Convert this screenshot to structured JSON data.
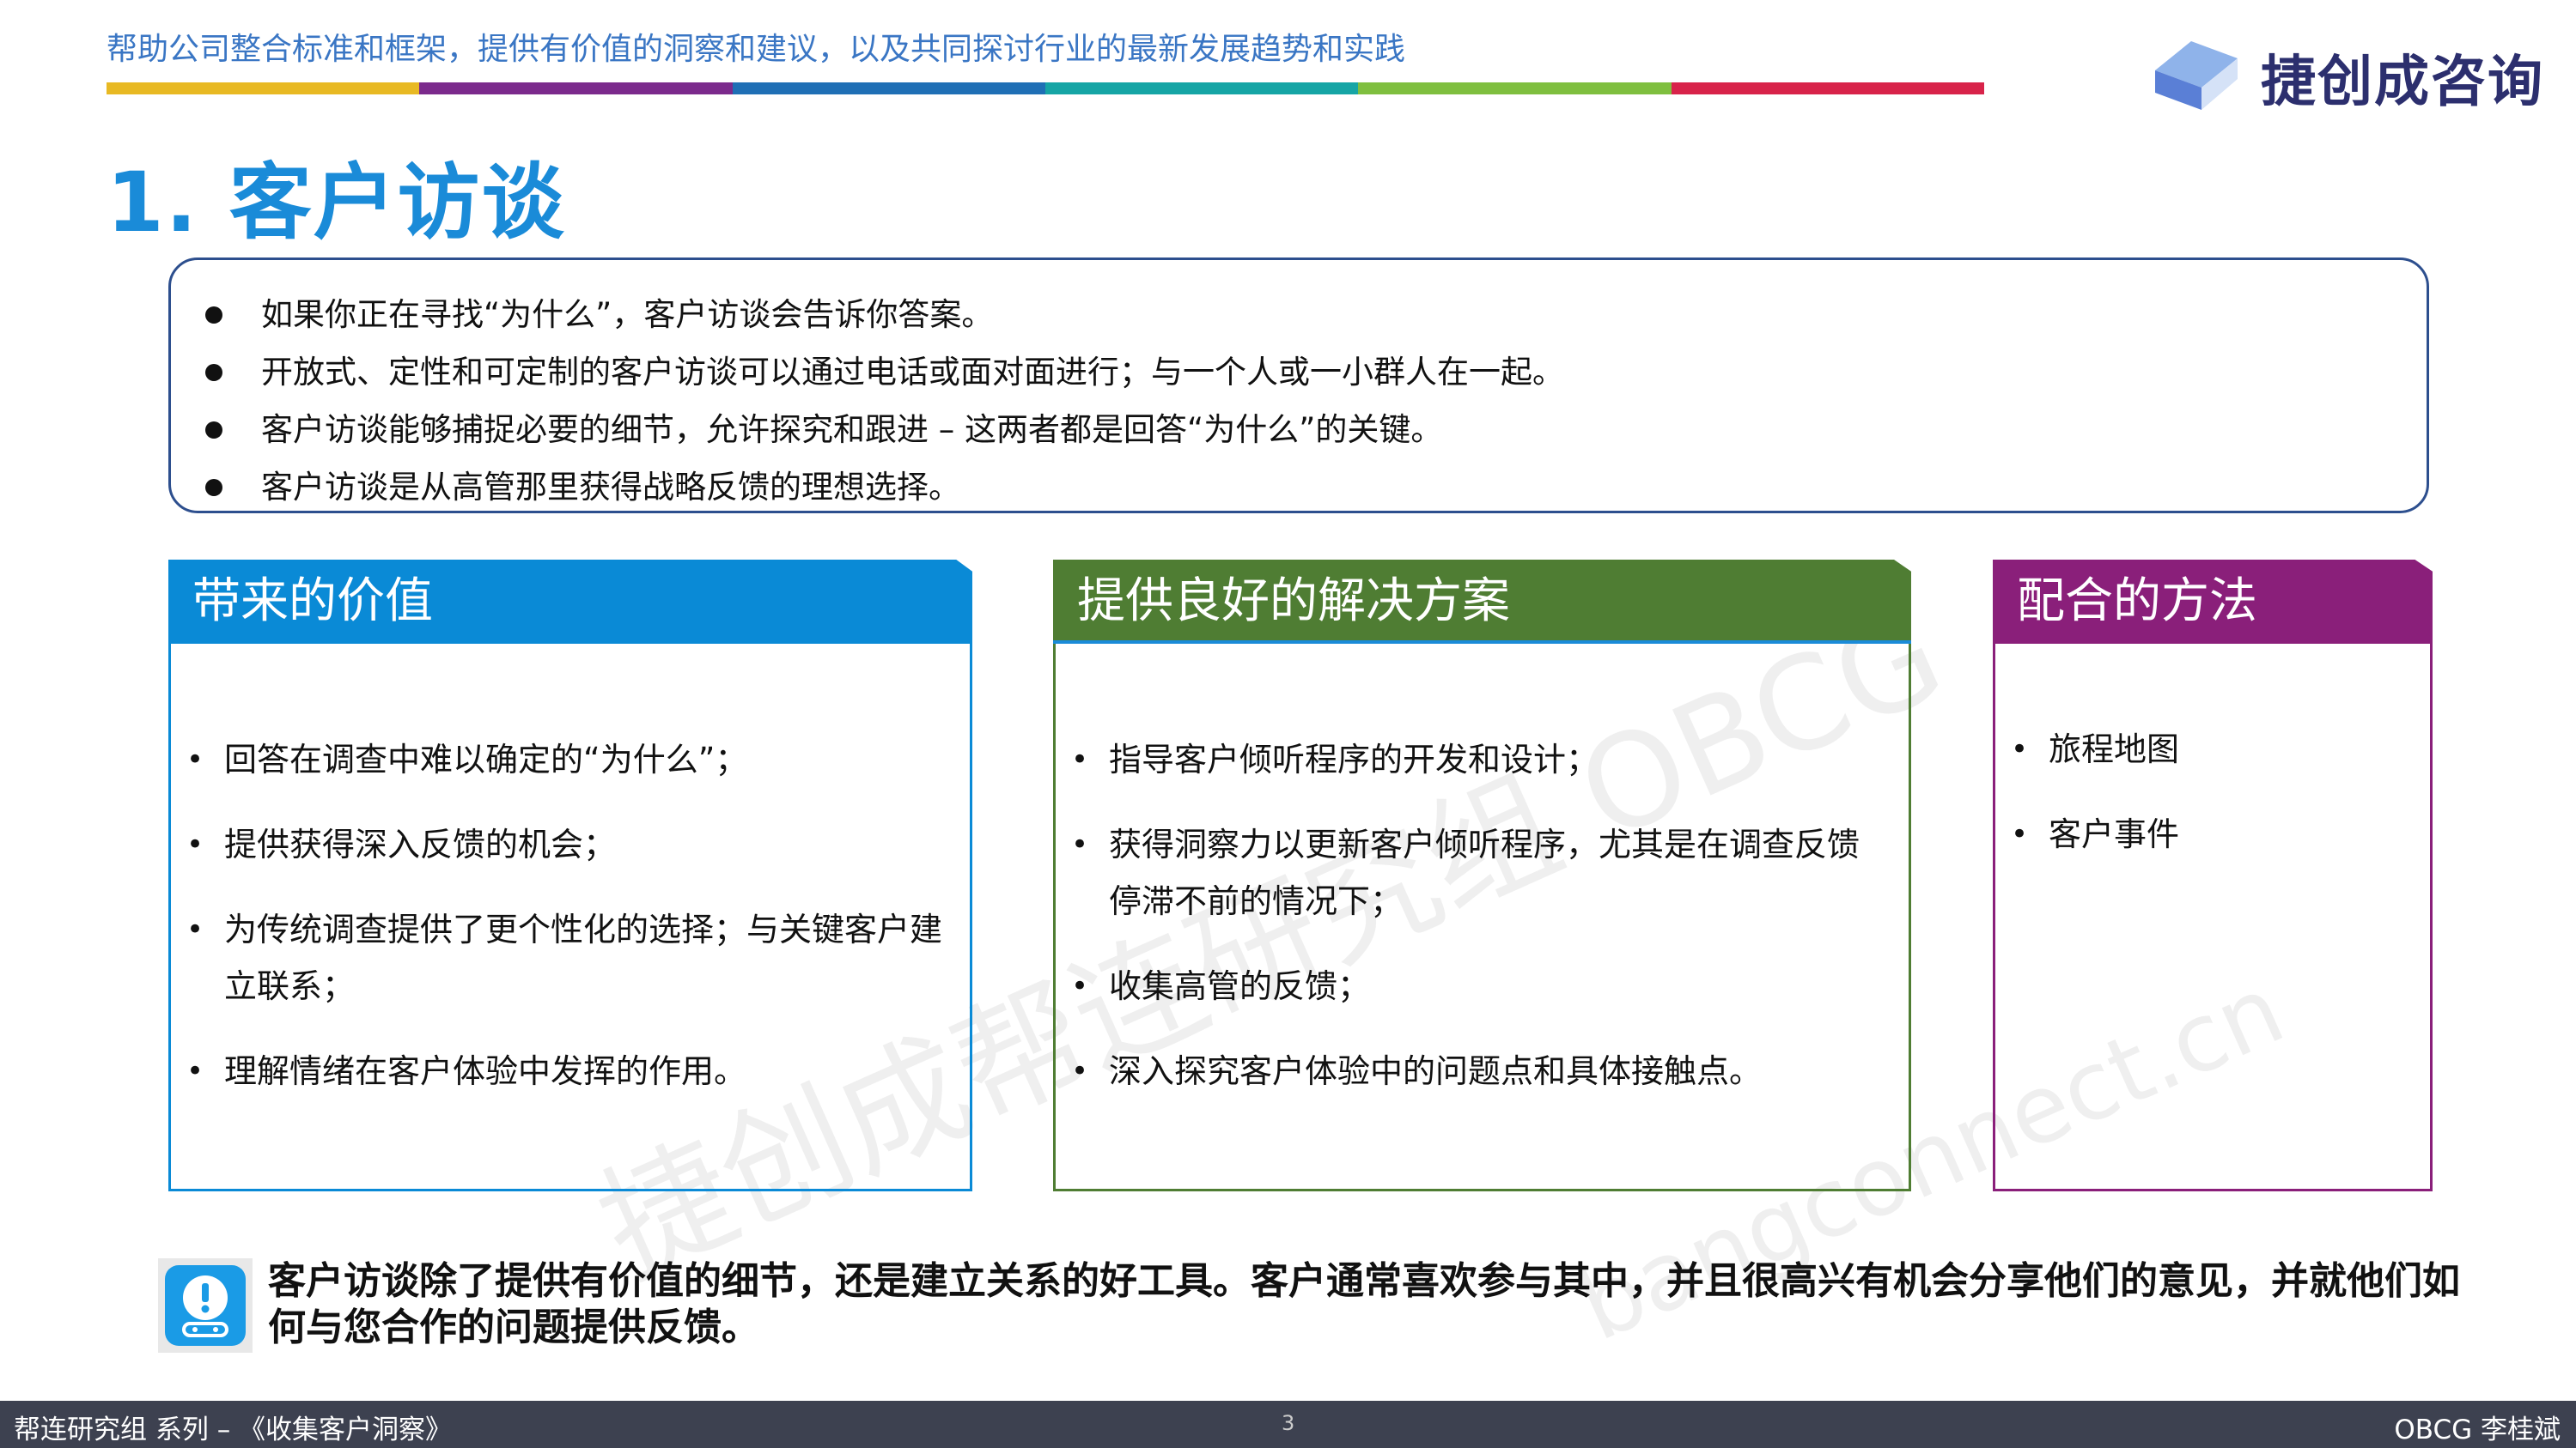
{
  "header": {
    "tagline": "帮助公司整合标准和框架，提供有价值的洞察和建议，以及共同探讨行业的最新发展趋势和实践",
    "stripe_colors": [
      "#e8b923",
      "#7b2a8c",
      "#1f6fb5",
      "#16a5a5",
      "#7fbf3f",
      "#d8234a"
    ],
    "logo_text": "捷创成咨询",
    "logo_colors": [
      "#5a7fd6",
      "#8fb3ea",
      "#d5e2f7"
    ]
  },
  "title": "1. 客户访谈",
  "intro": {
    "items": [
      "如果你正在寻找“为什么”，客户访谈会告诉你答案。",
      "开放式、定性和可定制的客户访谈可以通过电话或面对面进行；与一个人或一小群人在一起。",
      "客户访谈能够捕捉必要的细节，允许探究和跟进 – 这两者都是回答“为什么”的关键。",
      "客户访谈是从高管那里获得战略反馈的理想选择。"
    ]
  },
  "cards": {
    "value": {
      "title": "带来的价值",
      "color": "#0a8ad6",
      "items": [
        "回答在调查中难以确定的“为什么”；",
        "提供获得深入反馈的机会；",
        "为传统调查提供了更个性化的选择；与关键客户建立联系；",
        "理解情绪在客户体验中发挥的作用。"
      ]
    },
    "solution": {
      "title": "提供良好的解决方案",
      "color": "#4f7d33",
      "items": [
        "指导客户倾听程序的开发和设计；",
        "获得洞察力以更新客户倾听程序，尤其是在调查反馈停滞不前的情况下；",
        "收集高管的反馈；",
        "深入探究客户体验中的问题点和具体接触点。"
      ]
    },
    "method": {
      "title": "配合的方法",
      "color": "#8a1f7a",
      "items": [
        "旅程地图",
        "客户事件"
      ]
    }
  },
  "note": {
    "text": "客户访谈除了提供有价值的细节，还是建立关系的好工具。客户通常喜欢参与其中，并且很高兴有机会分享他们的意见，并就他们如何与您合作的问题提供反馈。",
    "icon": "alert-icon"
  },
  "footer": {
    "left": "帮连研究组 系列 – 《收集客户洞察》",
    "page": "3",
    "right": "OBCG 李桂斌"
  },
  "watermarks": {
    "main": "捷创成帮连研究组 OBCG",
    "site": "bangconnect.cn"
  }
}
